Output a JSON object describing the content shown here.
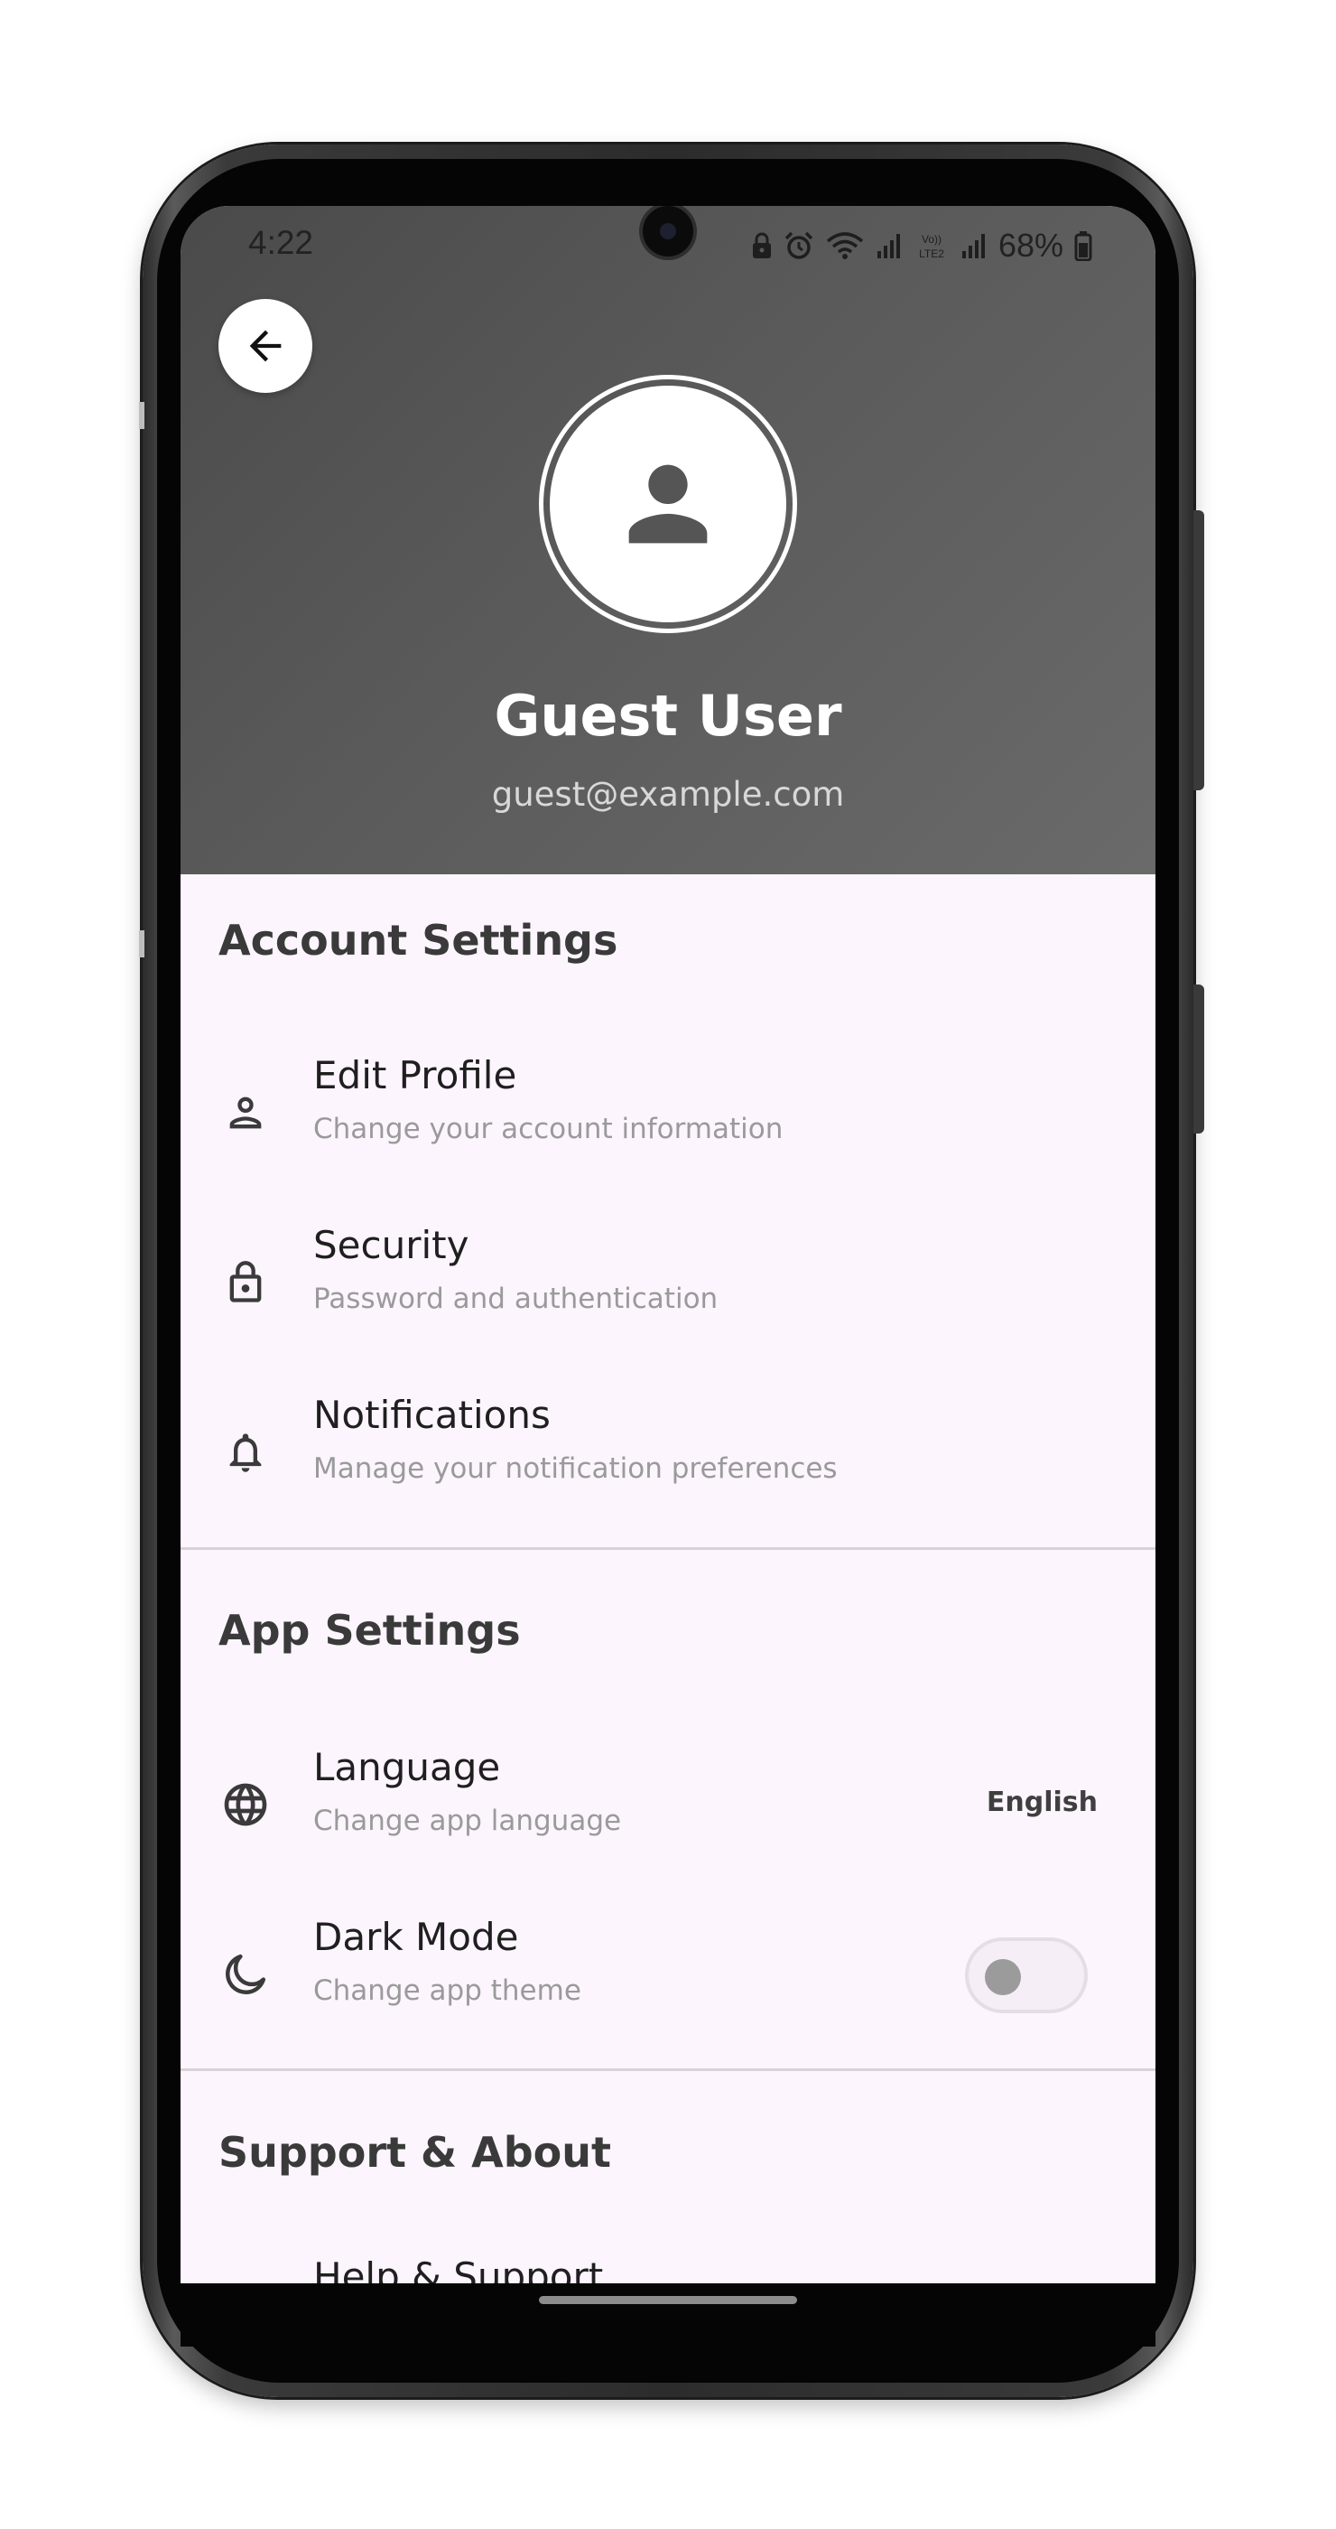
{
  "status_bar": {
    "time": "4:22",
    "battery": "68%",
    "icons": [
      "lock-icon",
      "alarm-icon",
      "wifi-icon",
      "signal-icon",
      "volte-icon",
      "signal-icon",
      "battery-icon"
    ]
  },
  "header": {
    "back_icon": "arrow-left-icon",
    "avatar_icon": "person-icon",
    "name": "Guest User",
    "email": "guest@example.com"
  },
  "sections": {
    "account": {
      "title": "Account Settings",
      "items": [
        {
          "icon": "person-outline-icon",
          "title": "Edit Profile",
          "subtitle": "Change your account information"
        },
        {
          "icon": "lock-icon",
          "title": "Security",
          "subtitle": "Password and authentication"
        },
        {
          "icon": "bell-icon",
          "title": "Notifications",
          "subtitle": "Manage your notification preferences"
        }
      ]
    },
    "app": {
      "title": "App Settings",
      "items": [
        {
          "icon": "globe-icon",
          "title": "Language",
          "subtitle": "Change app language",
          "value": "English"
        },
        {
          "icon": "moon-icon",
          "title": "Dark Mode",
          "subtitle": "Change app theme",
          "toggle_on": false
        }
      ]
    },
    "support": {
      "title": "Support & About",
      "items": [
        {
          "title": "Help & Support"
        }
      ]
    }
  },
  "colors": {
    "header_bg": "#5a5a5a",
    "content_bg": "#fcf5fd",
    "divider": "#d6d2d8"
  }
}
